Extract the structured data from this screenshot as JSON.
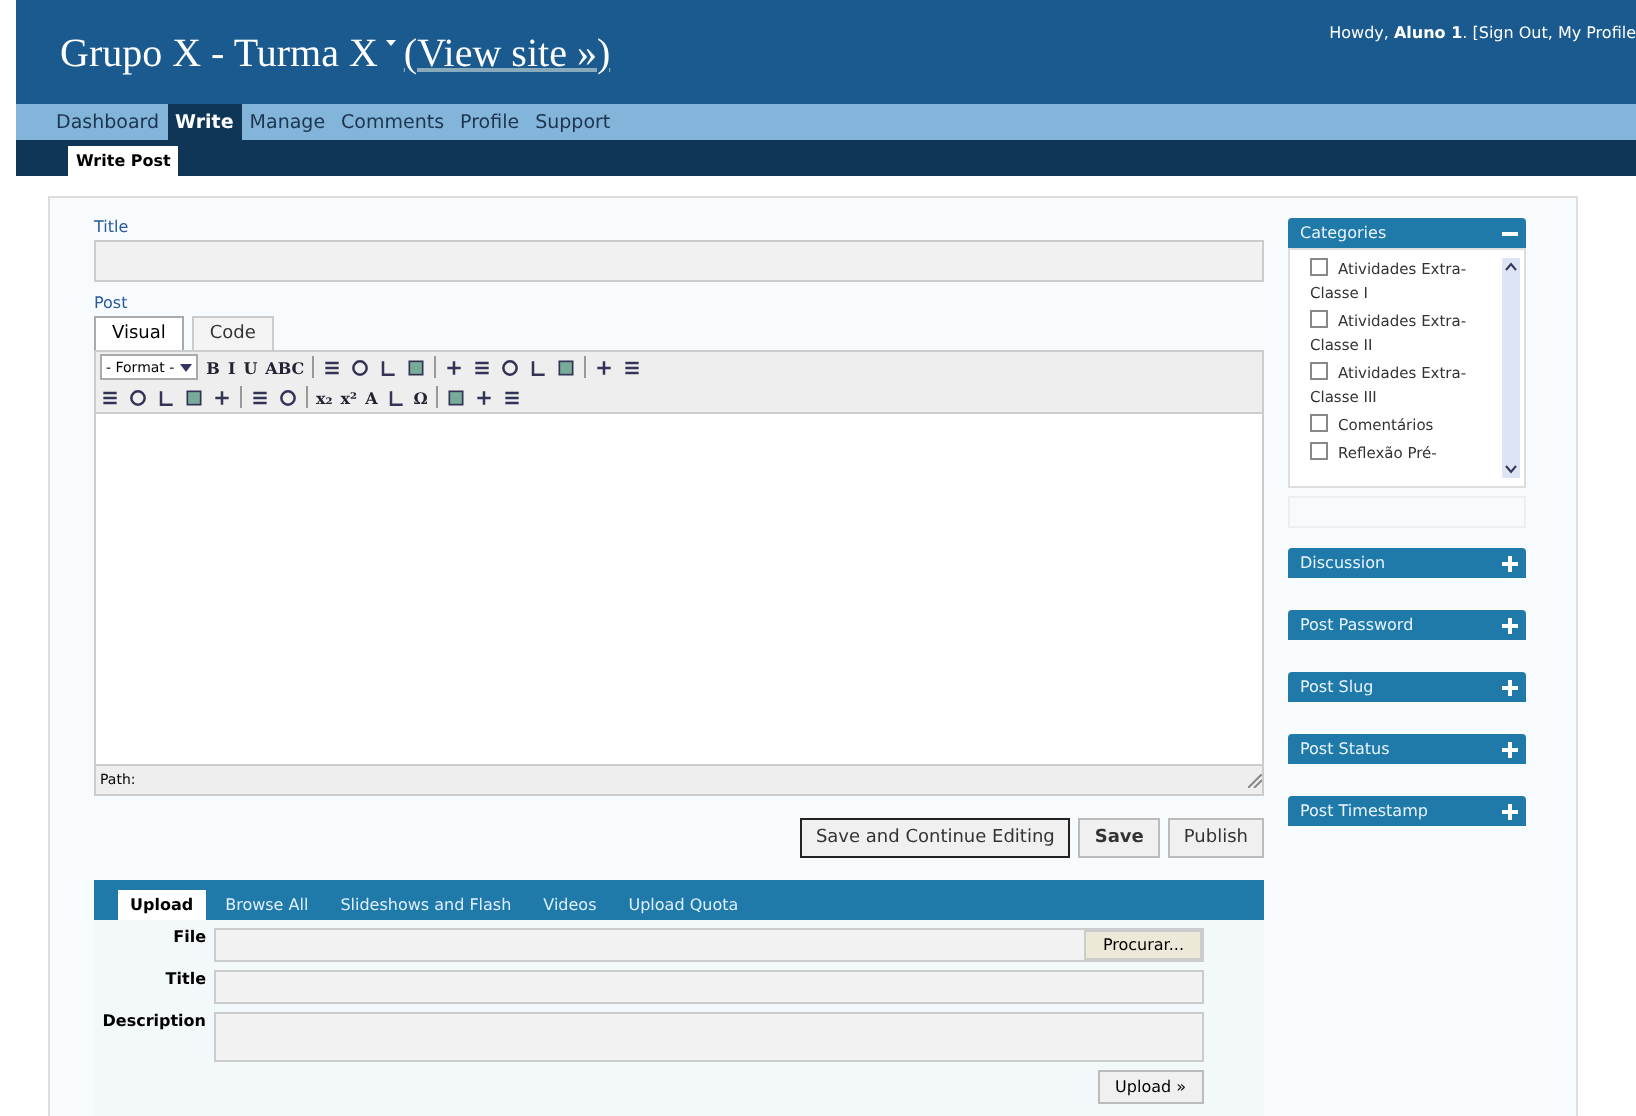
{
  "header": {
    "site_title": "Grupo X - Turma X",
    "view_site": "(View site »)",
    "user_text": "Howdy, **Aluno 1**. [Sign Out, My Profile"
  },
  "menu": [
    {
      "label": "Dashboard",
      "selected": false
    },
    {
      "label": "Write",
      "selected": true
    },
    {
      "label": "Manage",
      "selected": false
    },
    {
      "label": "Comments",
      "selected": false
    },
    {
      "label": "Profile",
      "selected": false
    },
    {
      "label": "Support",
      "selected": false
    }
  ],
  "submenu": [
    {
      "label": "Write Post",
      "selected": true
    }
  ],
  "editor": {
    "title_label": "Title",
    "post_label": "Post",
    "tabs": [
      {
        "label": "Visual",
        "selected": true
      },
      {
        "label": "Code",
        "selected": false
      }
    ],
    "format_select": "- Format -",
    "toolbar_1": [
      {
        "kind": "glyph",
        "label": "B"
      },
      {
        "kind": "glyph",
        "label": "I"
      },
      {
        "kind": "glyph",
        "label": "U"
      },
      {
        "kind": "glyph",
        "label": "ABC"
      },
      {
        "kind": "sep"
      },
      {
        "kind": "icon"
      },
      {
        "kind": "icon"
      },
      {
        "kind": "icon"
      },
      {
        "kind": "icon"
      },
      {
        "kind": "sep"
      },
      {
        "kind": "icon"
      },
      {
        "kind": "icon"
      },
      {
        "kind": "icon"
      },
      {
        "kind": "icon"
      },
      {
        "kind": "icon"
      },
      {
        "kind": "sep"
      },
      {
        "kind": "icon"
      },
      {
        "kind": "icon"
      }
    ],
    "toolbar_2": [
      {
        "kind": "icon"
      },
      {
        "kind": "icon"
      },
      {
        "kind": "icon"
      },
      {
        "kind": "icon"
      },
      {
        "kind": "icon"
      },
      {
        "kind": "sep"
      },
      {
        "kind": "icon"
      },
      {
        "kind": "icon"
      },
      {
        "kind": "sep"
      },
      {
        "kind": "glyph",
        "label": "x₂"
      },
      {
        "kind": "glyph",
        "label": "x²"
      },
      {
        "kind": "glyph",
        "label": "A"
      },
      {
        "kind": "icon"
      },
      {
        "kind": "glyph",
        "label": "Ω"
      },
      {
        "kind": "sep"
      },
      {
        "kind": "icon"
      },
      {
        "kind": "icon"
      },
      {
        "kind": "icon"
      }
    ],
    "path_label": "Path:"
  },
  "buttons": [
    {
      "label": "Save and Continue Editing",
      "kind": "focused"
    },
    {
      "label": "Save",
      "kind": "bold"
    },
    {
      "label": "Publish",
      "kind": "plain"
    }
  ],
  "upload": {
    "tabs": [
      {
        "label": "Upload",
        "selected": true
      },
      {
        "label": "Browse All",
        "selected": false
      },
      {
        "label": "Slideshows and Flash",
        "selected": false
      },
      {
        "label": "Videos",
        "selected": false
      },
      {
        "label": "Upload Quota",
        "selected": false
      }
    ],
    "file_label": "File",
    "browse_button": "Procurar...",
    "title_label": "Title",
    "description_label": "Description",
    "upload_button": "Upload »"
  },
  "sidebar": {
    "categories": {
      "title": "Categories",
      "expanded": true,
      "items": [
        {
          "label": "Atividades Extra-Classe I",
          "checked": false
        },
        {
          "label": "Atividades Extra-Classe II",
          "checked": false
        },
        {
          "label": "Atividades Extra-Classe III",
          "checked": false
        },
        {
          "label": "Comentários",
          "checked": false
        },
        {
          "label": "Reflexão Pré-",
          "checked": false
        }
      ]
    },
    "boxes": [
      {
        "title": "Discussion",
        "expanded": false
      },
      {
        "title": "Post Password",
        "expanded": false
      },
      {
        "title": "Post Slug",
        "expanded": false
      },
      {
        "title": "Post Status",
        "expanded": false
      },
      {
        "title": "Post Timestamp",
        "expanded": false
      }
    ]
  }
}
